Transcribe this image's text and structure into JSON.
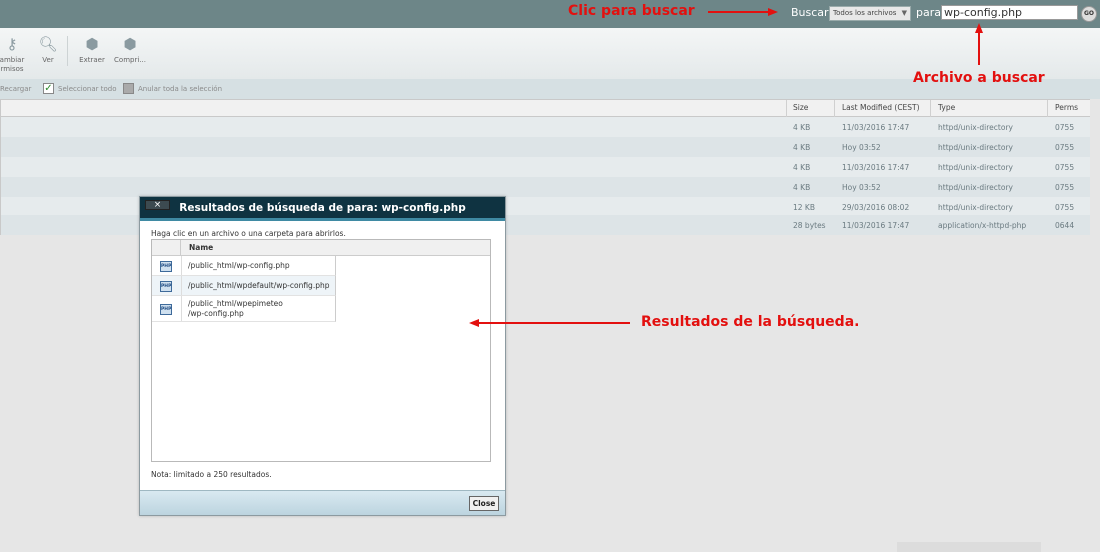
{
  "search": {
    "label": "Buscar",
    "scope": "Todos los archivos",
    "para_label": "para",
    "value": "wp-config.php",
    "go_label": "GO"
  },
  "toolbar": {
    "items": [
      {
        "label": "ambiar\nrmisos",
        "icon": "key-icon"
      },
      {
        "label": "Ver",
        "icon": "magnifier-icon"
      },
      {
        "label": "Extraer",
        "icon": "extract-icon"
      },
      {
        "label": "Compri...",
        "icon": "compress-icon"
      }
    ]
  },
  "selection_bar": {
    "reload": "Recargar",
    "select_all": "Seleccionar todo",
    "deselect_all": "Anular toda la selección"
  },
  "file_table": {
    "columns": [
      "Size",
      "Last Modified (CEST)",
      "Type",
      "Perms"
    ],
    "rows": [
      [
        "4 KB",
        "11/03/2016 17:47",
        "httpd/unix-directory",
        "0755"
      ],
      [
        "4 KB",
        "Hoy 03:52",
        "httpd/unix-directory",
        "0755"
      ],
      [
        "4 KB",
        "11/03/2016 17:47",
        "httpd/unix-directory",
        "0755"
      ],
      [
        "4 KB",
        "Hoy 03:52",
        "httpd/unix-directory",
        "0755"
      ],
      [
        "12 KB",
        "29/03/2016 08:02",
        "httpd/unix-directory",
        "0755"
      ],
      [
        "28 bytes",
        "11/03/2016 17:47",
        "application/x-httpd-php",
        "0644"
      ]
    ]
  },
  "dialog": {
    "close_glyph": "×",
    "title": "Resultados de búsqueda de para: wp-config.php",
    "hint": "Haga clic en un archivo o una carpeta para abrirlos.",
    "column_name": "Name",
    "icon_text": "PHP",
    "results": [
      "/public_html/wp-config.php",
      "/public_html/wpdefault/wp-config.php",
      "/public_html/wpepimeteo\n/wp-config.php"
    ],
    "note": "Nota: limitado a 250 resultados.",
    "close_button": "Close"
  },
  "annotations": {
    "click_search": "Clic para buscar",
    "file_to_search": "Archivo a buscar",
    "results": "Resultados de la búsqueda."
  },
  "colors": {
    "topbar": "#6d8688",
    "dialog_header": "#0f3341",
    "annotation_red": "#e3100f"
  }
}
